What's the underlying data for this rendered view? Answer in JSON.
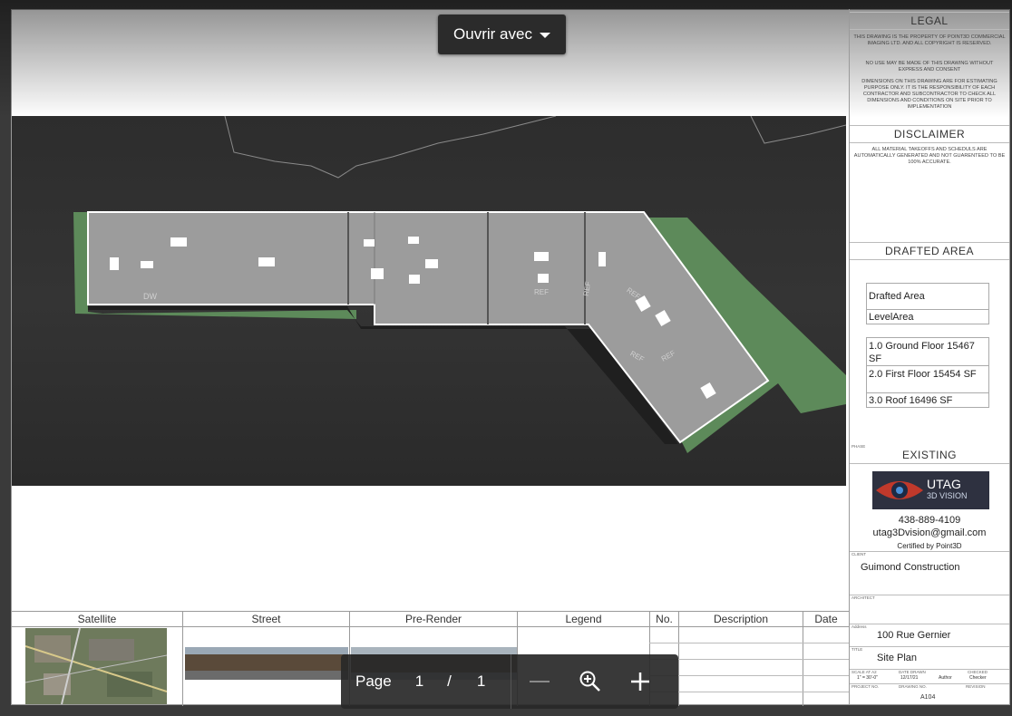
{
  "toolbar": {
    "open_with_label": "Ouvrir avec"
  },
  "title_block": {
    "legal_heading": "LEGAL",
    "legal_text_1": "THIS DRAWING IS THE PROPERTY OF POINT3D COMMERCIAL IMAGING LTD. AND ALL COPYRIGHT IS RESERVED.",
    "legal_text_2": "NO USE MAY BE MADE OF THIS DRAWING WITHOUT EXPRESS AND CONSENT",
    "legal_text_3": "DIMENSIONS ON THIS DRAWING ARE FOR ESTIMATING PURPOSE ONLY. IT IS THE RESPONSIBILITY OF EACH CONTRACTOR AND SUBCONTRACTOR TO CHECK ALL DIMENSIONS AND CONDITIONS ON SITE PRIOR TO IMPLEMENTATION",
    "disclaimer_heading": "DISCLAIMER",
    "disclaimer_text": "ALL MATERIAL TAKEOFFS AND SCHEDULS ARE AUTOMATICALLY GENERATED AND NOT GUARENTEED TO BE 100% ACCURATE.",
    "drafted_area_heading": "DRAFTED AREA",
    "drafted_area_table": {
      "col_header": "Drafted Area",
      "col_subheader": "LevelArea",
      "rows": [
        {
          "level": "1.0 Ground Floor",
          "area": "15467 SF"
        },
        {
          "level": "2.0 First Floor",
          "area": "15454 SF"
        },
        {
          "level": "3.0 Roof",
          "area": "16496 SF"
        }
      ]
    },
    "phase_label": "PHASE",
    "phase_value": "EXISTING",
    "logo_text_main": "UTAG",
    "logo_text_sub": "3D VISION",
    "phone": "438-889-4109",
    "email": "utag3Dvision@gmail.com",
    "certified": "Certified by Point3D",
    "client_label": "CLIENT",
    "client_value": "Guimond Construction",
    "architect_label": "ARCHITECT",
    "address_label": "Address",
    "address_value": "100 Rue Gernier",
    "title_label": "TITLE",
    "title_value": "Site Plan",
    "scale_label": "SCALE AT A2",
    "scale_value": "1\" = 30'-0\"",
    "date_label": "DATE DRAWN",
    "date_value": "12/17/21",
    "drawn_value": "Author",
    "checked_label": "CHECKED",
    "checked_value": "Checker",
    "project_label": "PROJECT NO.",
    "drawing_label": "DRAWING NO.",
    "drawing_value": "A104",
    "revision_label": "REVISION"
  },
  "bottom_strip": {
    "satellite": "Satellite",
    "street": "Street",
    "prerender": "Pre-Render",
    "legend": "Legend",
    "no": "No.",
    "description": "Description",
    "date": "Date"
  },
  "plan_labels": {
    "dw": "DW",
    "ref1": "REF",
    "ref2": "REF",
    "ref3": "REF",
    "ref4": "REF",
    "ref5": "REF"
  },
  "pager": {
    "page_label": "Page",
    "current": "1",
    "sep": "/",
    "total": "1"
  },
  "colors": {
    "roof": "#9c9c9c",
    "grass": "#5d8a5a",
    "ground": "#2f2f2f"
  }
}
